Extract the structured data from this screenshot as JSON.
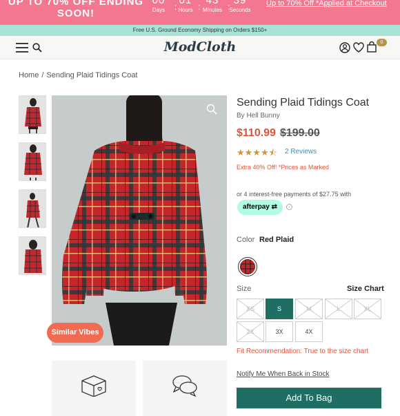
{
  "promo": {
    "headline_1": "UP TO 70% OFF ENDING",
    "headline_2": "SOON!",
    "countdown": [
      {
        "value": "00",
        "unit": "Days"
      },
      {
        "value": "01",
        "unit": "Hours"
      },
      {
        "value": "43",
        "unit": "Minutes"
      },
      {
        "value": "39",
        "unit": "Seconds"
      }
    ],
    "separator": ":",
    "offer_link": "Up to 70% Off *Applied at Checkout",
    "bg_color": "#f2778f"
  },
  "shipping_bar": {
    "text": "Free U.S. Ground Economy Shipping on Orders $150+",
    "bg_color": "#a9e3d8"
  },
  "nav": {
    "logo": "ModCloth",
    "icons": [
      "hamburger-menu-icon",
      "search-icon",
      "account-icon",
      "heart-icon",
      "shopping-bag-icon"
    ],
    "cart_count": "0"
  },
  "breadcrumb": {
    "home": "Home",
    "separator": "/",
    "current": "Sending Plaid Tidings Coat"
  },
  "gallery": {
    "thumbnail_count": 4,
    "similar_button": "Similar Vibes",
    "zoom_icon": "magnifier-icon"
  },
  "product": {
    "title": "Sending Plaid Tidings Coat",
    "brand": "By Hell Bunny",
    "sale_price": "$110.99",
    "original_price": "$199.00",
    "rating": 4.5,
    "stars": "★★★★⯪",
    "reviews_link": "2 Reviews",
    "promo_note": "Extra 40% Off! *Prices as Marked",
    "installment_text": "or 4 interest-free payments of $27.75 with",
    "afterpay_label": "afterpay",
    "info_glyph": "i",
    "color_label": "Color",
    "color_value": "Red Plaid",
    "size_label": "Size",
    "size_chart_link": "Size Chart",
    "sizes": [
      {
        "label": "XS",
        "state": "unavailable"
      },
      {
        "label": "S",
        "state": "selected"
      },
      {
        "label": "M",
        "state": "unavailable"
      },
      {
        "label": "L",
        "state": "unavailable"
      },
      {
        "label": "XL",
        "state": "unavailable"
      },
      {
        "label": "2X",
        "state": "unavailable"
      },
      {
        "label": "3X",
        "state": "available"
      },
      {
        "label": "4X",
        "state": "available"
      }
    ],
    "fit_text": "Fit Recommendation: True to the size chart",
    "notify_link": "Notify Me When Back in Stock",
    "add_to_bag": "Add To Bag",
    "accent_color": "#1f6e64",
    "sale_color": "#e0533a"
  },
  "info_cards": [
    "box-heart-icon",
    "chat-bubbles-icon"
  ]
}
